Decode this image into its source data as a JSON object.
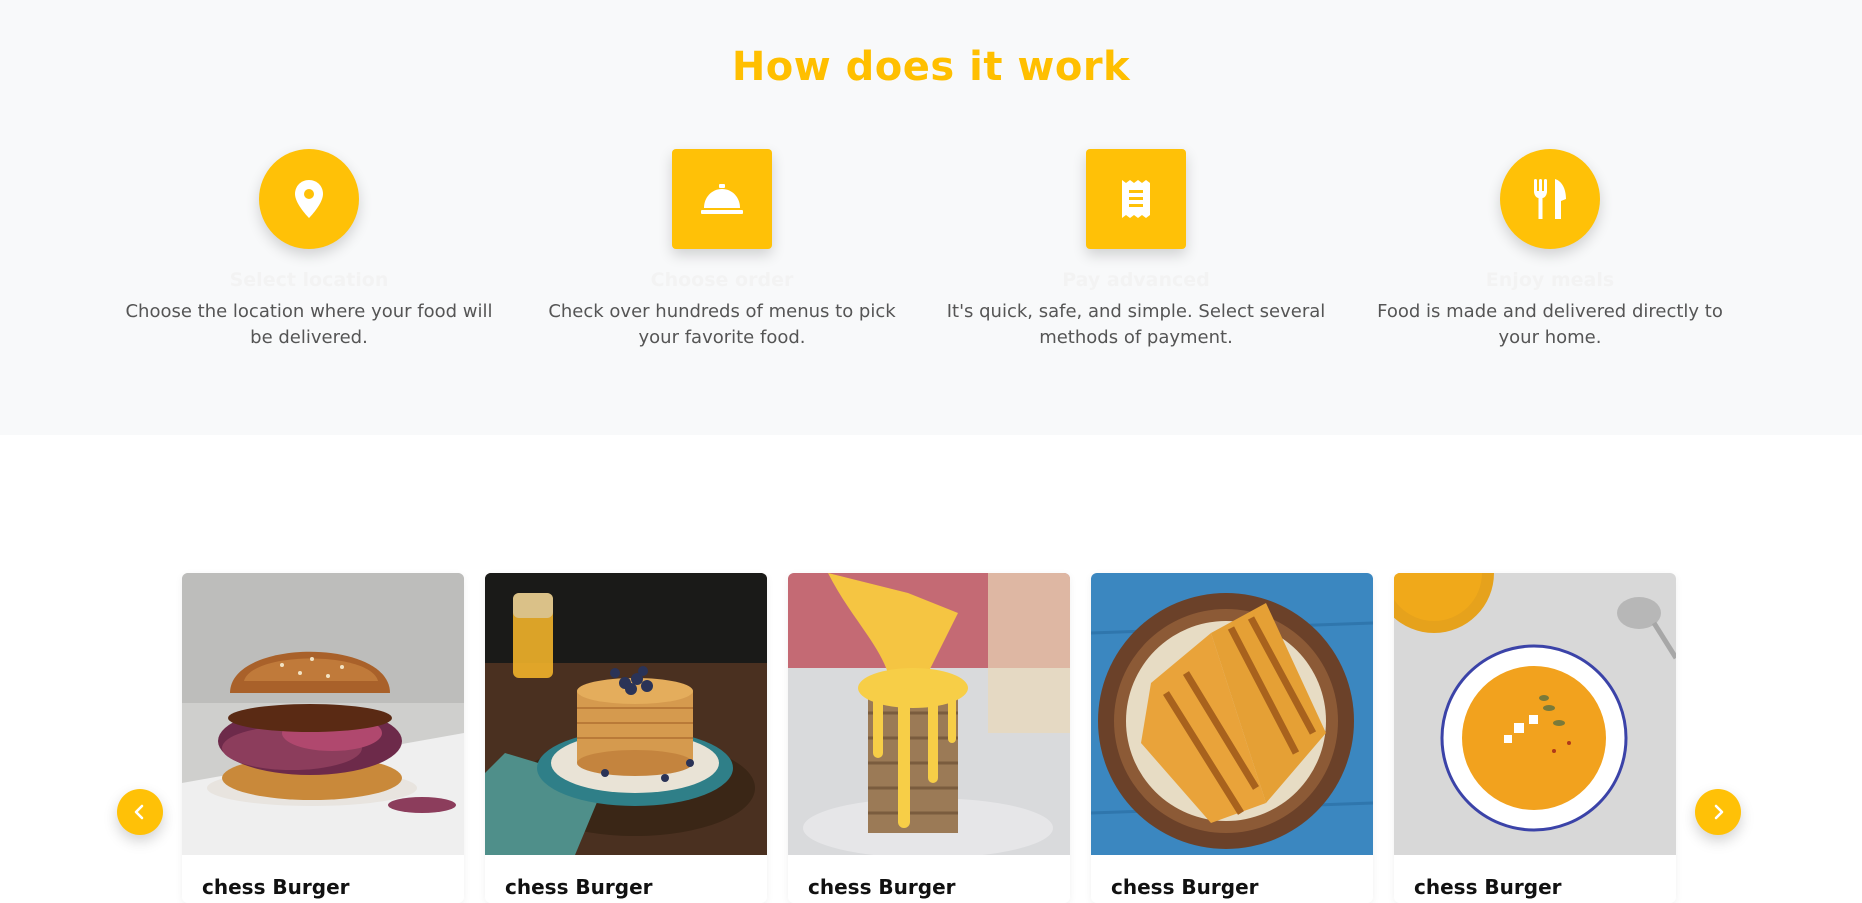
{
  "how_section": {
    "title": "How does it work",
    "steps": [
      {
        "icon": "map-pin-icon",
        "title": "Select location",
        "description": "Choose the location where your food will be delivered."
      },
      {
        "icon": "service-bell-icon",
        "title": "Choose order",
        "description": "Check over hundreds of menus to pick your favorite food."
      },
      {
        "icon": "receipt-icon",
        "title": "Pay advanced",
        "description": "It's quick, safe, and simple. Select several methods of payment."
      },
      {
        "icon": "utensils-icon",
        "title": "Enjoy meals",
        "description": "Food is made and delivered directly to your home."
      }
    ]
  },
  "carousel": {
    "prev_icon": "chevron-left-icon",
    "next_icon": "chevron-right-icon",
    "cards": [
      {
        "title": "chess Burger",
        "image": "burger-photo"
      },
      {
        "title": "chess Burger",
        "image": "blueberry-pancakes-photo"
      },
      {
        "title": "chess Burger",
        "image": "honey-pancakes-photo"
      },
      {
        "title": "chess Burger",
        "image": "grilled-sandwich-photo"
      },
      {
        "title": "chess Burger",
        "image": "pumpkin-soup-photo"
      }
    ]
  },
  "colors": {
    "accent": "#ffc107",
    "title": "#ffbf00",
    "section_bg": "#f8f9fa"
  }
}
